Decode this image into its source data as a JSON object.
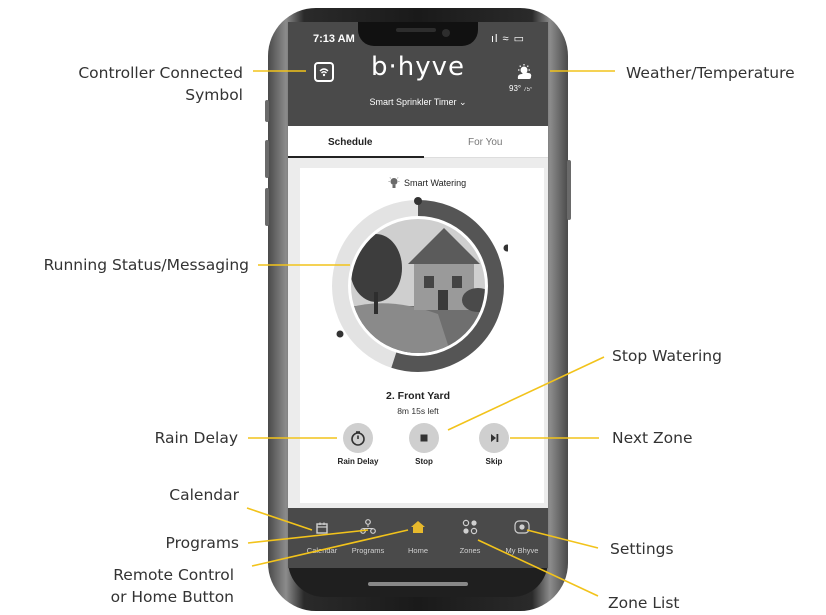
{
  "status_bar": {
    "time": "7:13 AM",
    "icons": "ıl ≈ ▭"
  },
  "header": {
    "logo": "b·hyve",
    "device_name": "Smart Sprinkler Timer  ⌄",
    "weather": {
      "temp": "93°",
      "low": "75°"
    }
  },
  "tabs": [
    {
      "label": "Schedule"
    },
    {
      "label": "For You"
    }
  ],
  "smart_watering": {
    "label": "Smart Watering"
  },
  "progress": {
    "fraction": 0.55,
    "dots": [
      "1",
      "2",
      "3"
    ]
  },
  "zone": {
    "name": "2. Front Yard",
    "time_left": "8m 15s left"
  },
  "controls": [
    {
      "label": "Rain Delay",
      "icon": "timer-icon"
    },
    {
      "label": "Stop",
      "icon": "stop-icon"
    },
    {
      "label": "Skip",
      "icon": "skip-icon"
    }
  ],
  "nav": [
    {
      "label": "Calendar",
      "icon": "calendar-icon"
    },
    {
      "label": "Programs",
      "icon": "programs-icon"
    },
    {
      "label": "Home",
      "icon": "home-icon"
    },
    {
      "label": "Zones",
      "icon": "zones-icon"
    },
    {
      "label": "My Bhyve",
      "icon": "settings-icon"
    }
  ],
  "callouts": {
    "controller_connected": "Controller Connected\nSymbol",
    "running_status": "Running Status/Messaging",
    "rain_delay": "Rain Delay",
    "calendar": "Calendar",
    "programs": "Programs",
    "remote_control": "Remote Control\nor Home Button",
    "weather_temperature": "Weather/Temperature",
    "stop_watering": "Stop Watering",
    "next_zone": "Next Zone",
    "settings": "Settings",
    "zone_list": "Zone List"
  },
  "colors": {
    "callout_line": "#f2c31b",
    "header": "#4a4a4a",
    "ring_active": "#555555",
    "ring_track": "#e3e3e3"
  }
}
